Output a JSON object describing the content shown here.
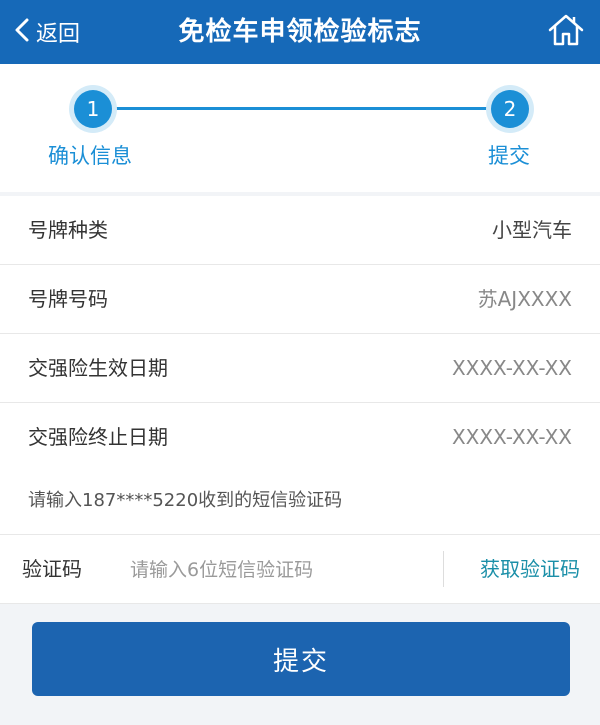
{
  "header": {
    "back_label": "返回",
    "title": "免检车申领检验标志",
    "home_icon": "home-icon",
    "back_icon": "chevron-left-icon"
  },
  "stepper": {
    "steps": [
      {
        "number": "1",
        "label": "确认信息"
      },
      {
        "number": "2",
        "label": "提交"
      }
    ]
  },
  "info": {
    "rows": [
      {
        "label": "号牌种类",
        "value": "小型汽车"
      },
      {
        "label": "号牌号码",
        "value": "苏AJXXXX"
      },
      {
        "label": "交强险生效日期",
        "value": "XXXX-XX-XX"
      },
      {
        "label": "交强险终止日期",
        "value": "XXXX-XX-XX"
      }
    ]
  },
  "sms": {
    "tip": "请输入187****5220收到的短信验证码",
    "code_label": "验证码",
    "code_placeholder": "请输入6位短信验证码",
    "code_value": "",
    "get_code_label": "获取验证码"
  },
  "actions": {
    "submit_label": "提交"
  },
  "colors": {
    "header_bg": "#1669b8",
    "step_accent": "#1b8fd6",
    "submit_bg": "#1c64b0",
    "link": "#1b8fa8"
  }
}
